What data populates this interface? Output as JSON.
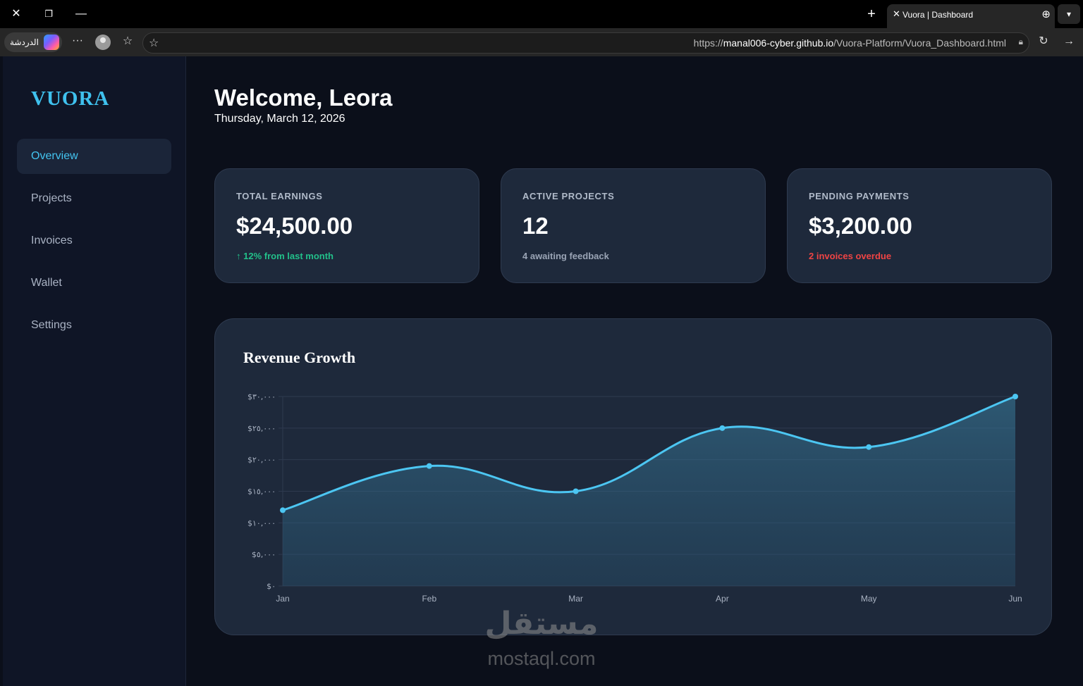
{
  "browser": {
    "tab_title": "Vuora | Dashboard",
    "url_prefix": "https://",
    "url_host": "manal006-cyber.github.io",
    "url_path": "/Vuora-Platform/Vuora_Dashboard.html",
    "copilot_label": "الدردشة"
  },
  "sidebar": {
    "logo": "VUORA",
    "items": [
      {
        "label": "Overview",
        "active": true
      },
      {
        "label": "Projects",
        "active": false
      },
      {
        "label": "Invoices",
        "active": false
      },
      {
        "label": "Wallet",
        "active": false
      },
      {
        "label": "Settings",
        "active": false
      }
    ]
  },
  "header": {
    "welcome": "Welcome, Leora",
    "date": "Thursday, March 12, 2026"
  },
  "stats": [
    {
      "label": "TOTAL EARNINGS",
      "value": "$24,500.00",
      "note": "↑ 12% from last month",
      "note_color": "#22c08a"
    },
    {
      "label": "ACTIVE PROJECTS",
      "value": "12",
      "note": "4 awaiting feedback",
      "note_color": "#9aa4b5"
    },
    {
      "label": "PENDING PAYMENTS",
      "value": "$3,200.00",
      "note": "2 invoices overdue",
      "note_color": "#ef4444"
    }
  ],
  "chart": {
    "title": "Revenue Growth"
  },
  "chart_data": {
    "type": "area",
    "title": "Revenue Growth",
    "categories": [
      "Jan",
      "Feb",
      "Mar",
      "Apr",
      "May",
      "Jun"
    ],
    "series": [
      {
        "values": [
          12000,
          19000,
          15000,
          25000,
          22000,
          30000
        ]
      }
    ],
    "ylim": [
      0,
      30000
    ],
    "y_ticks": [
      0,
      5000,
      10000,
      15000,
      20000,
      25000,
      30000
    ],
    "y_tick_labels": [
      "$٠",
      "$٥,٠٠٠",
      "$١٠,٠٠٠",
      "$١٥,٠٠٠",
      "$٢٠,٠٠٠",
      "$٢٥,٠٠٠",
      "$٣٠,٠٠٠"
    ],
    "grid": true,
    "line_color": "#4cc6f2"
  },
  "watermark": {
    "arabic": "مستقل",
    "latin": "mostaql.com"
  }
}
